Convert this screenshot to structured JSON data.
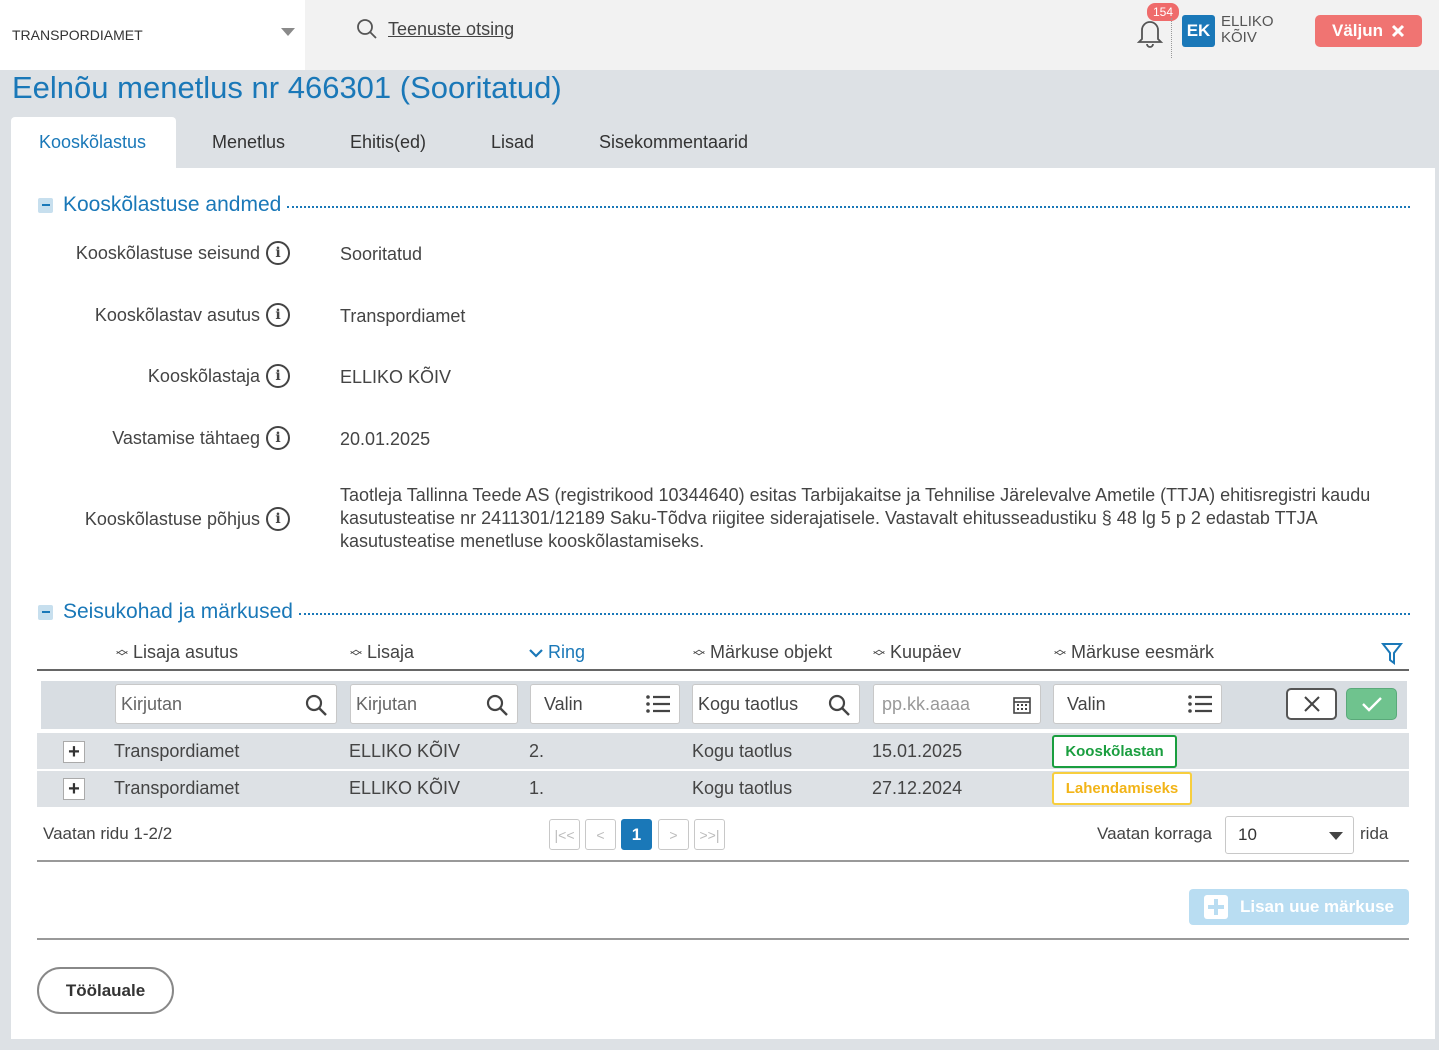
{
  "header": {
    "org_select": "TRANSPORDIAMET",
    "search_label": "Teenuste otsing",
    "notification_count": "154",
    "user_initials": "EK",
    "user_name_first": "ELLIKO",
    "user_name_last": "KÕIV",
    "logout_label": "Väljun"
  },
  "page_title": "Eelnõu menetlus nr 466301 (Sooritatud)",
  "tabs": [
    {
      "label": "Kooskõlastus",
      "active": true
    },
    {
      "label": "Menetlus"
    },
    {
      "label": "Ehitis(ed)"
    },
    {
      "label": "Lisad"
    },
    {
      "label": "Sisekommentaarid"
    }
  ],
  "details": {
    "title": "Kooskõlastuse andmed",
    "fields": [
      {
        "label": "Kooskõlastuse seisund",
        "value": "Sooritatud"
      },
      {
        "label": "Kooskõlastav asutus",
        "value": "Transpordiamet"
      },
      {
        "label": "Kooskõlastaja",
        "value": "ELLIKO KÕIV"
      },
      {
        "label": "Vastamise tähtaeg",
        "value": "20.01.2025"
      },
      {
        "label": "Kooskõlastuse põhjus",
        "value": "Taotleja Tallinna Teede AS (registrikood 10344640) esitas Tarbijakaitse ja Tehnilise Järelevalve Ametile (TTJA) ehitisregistri kaudu kasutusteatise nr 2411301/12189 Saku-Tõdva riigitee siderajatisele. Vastavalt ehitusseadustiku § 48 lg 5 p 2 edastab TTJA kasutusteatise menetluse kooskõlastamiseks."
      }
    ]
  },
  "remarks": {
    "title": "Seisukohad ja märkused",
    "columns": [
      "Lisaja asutus",
      "Lisaja",
      "Ring",
      "Märkuse objekt",
      "Kuupäev",
      "Märkuse eesmärk"
    ],
    "filters": {
      "org_placeholder": "Kirjutan",
      "adder_placeholder": "Kirjutan",
      "ring_value": "Valin",
      "object_value": "Kogu taotlus",
      "date_placeholder": "pp.kk.aaaa",
      "purpose_value": "Valin"
    },
    "rows": [
      {
        "org": "Transpordiamet",
        "adder": "ELLIKO KÕIV",
        "ring": "2.",
        "object": "Kogu taotlus",
        "date": "15.01.2025",
        "purpose": "Kooskõlastan",
        "purpose_color": "#1a9e3f"
      },
      {
        "org": "Transpordiamet",
        "adder": "ELLIKO KÕIV",
        "ring": "1.",
        "object": "Kogu taotlus",
        "date": "27.12.2024",
        "purpose": "Lahendamiseks",
        "purpose_color": "#f2b418"
      }
    ],
    "pager_info": "Vaatan ridu 1-2/2",
    "current_page": "1",
    "rows_prefix": "Vaatan korraga",
    "rows_per_page": "10",
    "rows_suffix": "rida",
    "add_button": "Lisan uue märkuse"
  },
  "back_button": "Töölauale",
  "colors": {
    "accent": "#1a78b8",
    "logout": "#f07472",
    "approve": "#1a9e3f",
    "pending": "#f2b418"
  }
}
